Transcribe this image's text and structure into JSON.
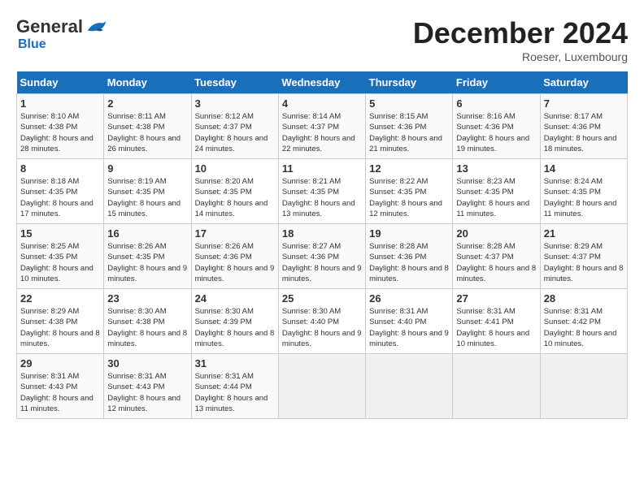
{
  "header": {
    "logo_general": "General",
    "logo_blue": "Blue",
    "month_title": "December 2024",
    "location": "Roeser, Luxembourg"
  },
  "days_of_week": [
    "Sunday",
    "Monday",
    "Tuesday",
    "Wednesday",
    "Thursday",
    "Friday",
    "Saturday"
  ],
  "weeks": [
    [
      {
        "day": "1",
        "sunrise": "8:10 AM",
        "sunset": "4:38 PM",
        "daylight": "8 hours and 28 minutes."
      },
      {
        "day": "2",
        "sunrise": "8:11 AM",
        "sunset": "4:38 PM",
        "daylight": "8 hours and 26 minutes."
      },
      {
        "day": "3",
        "sunrise": "8:12 AM",
        "sunset": "4:37 PM",
        "daylight": "8 hours and 24 minutes."
      },
      {
        "day": "4",
        "sunrise": "8:14 AM",
        "sunset": "4:37 PM",
        "daylight": "8 hours and 22 minutes."
      },
      {
        "day": "5",
        "sunrise": "8:15 AM",
        "sunset": "4:36 PM",
        "daylight": "8 hours and 21 minutes."
      },
      {
        "day": "6",
        "sunrise": "8:16 AM",
        "sunset": "4:36 PM",
        "daylight": "8 hours and 19 minutes."
      },
      {
        "day": "7",
        "sunrise": "8:17 AM",
        "sunset": "4:36 PM",
        "daylight": "8 hours and 18 minutes."
      }
    ],
    [
      {
        "day": "8",
        "sunrise": "8:18 AM",
        "sunset": "4:35 PM",
        "daylight": "8 hours and 17 minutes."
      },
      {
        "day": "9",
        "sunrise": "8:19 AM",
        "sunset": "4:35 PM",
        "daylight": "8 hours and 15 minutes."
      },
      {
        "day": "10",
        "sunrise": "8:20 AM",
        "sunset": "4:35 PM",
        "daylight": "8 hours and 14 minutes."
      },
      {
        "day": "11",
        "sunrise": "8:21 AM",
        "sunset": "4:35 PM",
        "daylight": "8 hours and 13 minutes."
      },
      {
        "day": "12",
        "sunrise": "8:22 AM",
        "sunset": "4:35 PM",
        "daylight": "8 hours and 12 minutes."
      },
      {
        "day": "13",
        "sunrise": "8:23 AM",
        "sunset": "4:35 PM",
        "daylight": "8 hours and 11 minutes."
      },
      {
        "day": "14",
        "sunrise": "8:24 AM",
        "sunset": "4:35 PM",
        "daylight": "8 hours and 11 minutes."
      }
    ],
    [
      {
        "day": "15",
        "sunrise": "8:25 AM",
        "sunset": "4:35 PM",
        "daylight": "8 hours and 10 minutes."
      },
      {
        "day": "16",
        "sunrise": "8:26 AM",
        "sunset": "4:35 PM",
        "daylight": "8 hours and 9 minutes."
      },
      {
        "day": "17",
        "sunrise": "8:26 AM",
        "sunset": "4:36 PM",
        "daylight": "8 hours and 9 minutes."
      },
      {
        "day": "18",
        "sunrise": "8:27 AM",
        "sunset": "4:36 PM",
        "daylight": "8 hours and 9 minutes."
      },
      {
        "day": "19",
        "sunrise": "8:28 AM",
        "sunset": "4:36 PM",
        "daylight": "8 hours and 8 minutes."
      },
      {
        "day": "20",
        "sunrise": "8:28 AM",
        "sunset": "4:37 PM",
        "daylight": "8 hours and 8 minutes."
      },
      {
        "day": "21",
        "sunrise": "8:29 AM",
        "sunset": "4:37 PM",
        "daylight": "8 hours and 8 minutes."
      }
    ],
    [
      {
        "day": "22",
        "sunrise": "8:29 AM",
        "sunset": "4:38 PM",
        "daylight": "8 hours and 8 minutes."
      },
      {
        "day": "23",
        "sunrise": "8:30 AM",
        "sunset": "4:38 PM",
        "daylight": "8 hours and 8 minutes."
      },
      {
        "day": "24",
        "sunrise": "8:30 AM",
        "sunset": "4:39 PM",
        "daylight": "8 hours and 8 minutes."
      },
      {
        "day": "25",
        "sunrise": "8:30 AM",
        "sunset": "4:40 PM",
        "daylight": "8 hours and 9 minutes."
      },
      {
        "day": "26",
        "sunrise": "8:31 AM",
        "sunset": "4:40 PM",
        "daylight": "8 hours and 9 minutes."
      },
      {
        "day": "27",
        "sunrise": "8:31 AM",
        "sunset": "4:41 PM",
        "daylight": "8 hours and 10 minutes."
      },
      {
        "day": "28",
        "sunrise": "8:31 AM",
        "sunset": "4:42 PM",
        "daylight": "8 hours and 10 minutes."
      }
    ],
    [
      {
        "day": "29",
        "sunrise": "8:31 AM",
        "sunset": "4:43 PM",
        "daylight": "8 hours and 11 minutes."
      },
      {
        "day": "30",
        "sunrise": "8:31 AM",
        "sunset": "4:43 PM",
        "daylight": "8 hours and 12 minutes."
      },
      {
        "day": "31",
        "sunrise": "8:31 AM",
        "sunset": "4:44 PM",
        "daylight": "8 hours and 13 minutes."
      },
      null,
      null,
      null,
      null
    ]
  ],
  "labels": {
    "sunrise_prefix": "Sunrise: ",
    "sunset_prefix": "Sunset: ",
    "daylight_prefix": "Daylight: "
  }
}
